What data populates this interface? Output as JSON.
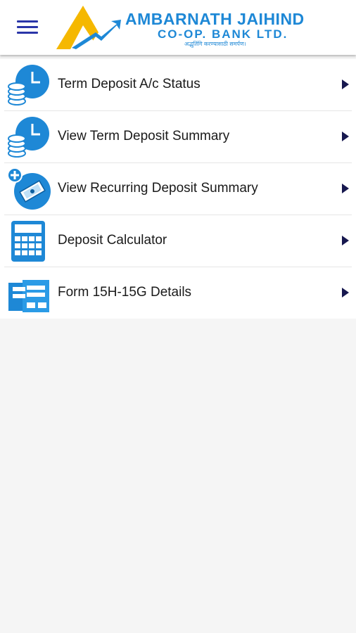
{
  "header": {
    "brand_line1": "AMBARNATH JAIHIND",
    "brand_line2": "CO-OP. BANK LTD.",
    "tagline": "अद्भुतिंगि करण्यासाठी समर्पण।"
  },
  "menu": {
    "items": [
      {
        "label": "Term Deposit A/c Status",
        "icon": "clock-coins-icon"
      },
      {
        "label": "View Term Deposit Summary",
        "icon": "clock-coins-icon"
      },
      {
        "label": "View Recurring Deposit Summary",
        "icon": "cash-plus-icon"
      },
      {
        "label": "Deposit Calculator",
        "icon": "calculator-icon"
      },
      {
        "label": "Form 15H-15G Details",
        "icon": "forms-icon"
      }
    ]
  },
  "colors": {
    "accent": "#1e88d6",
    "arrow": "#17184f",
    "menu_icon": "#2a35a8"
  }
}
